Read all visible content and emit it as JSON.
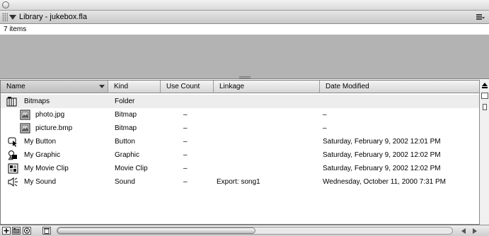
{
  "panel": {
    "title": "Library - jukebox.fla",
    "item_count": "7 items"
  },
  "columns": {
    "name": "Name",
    "kind": "Kind",
    "use_count": "Use Count",
    "linkage": "Linkage",
    "date_modified": "Date Modified"
  },
  "items": [
    {
      "name": "Bitmaps",
      "kind": "Folder",
      "use_count": "",
      "linkage": "",
      "date": "",
      "icon": "folder-icon"
    },
    {
      "name": "photo.jpg",
      "kind": "Bitmap",
      "use_count": "–",
      "linkage": "",
      "date": "–",
      "icon": "bitmap-icon"
    },
    {
      "name": "picture.bmp",
      "kind": "Bitmap",
      "use_count": "–",
      "linkage": "",
      "date": "–",
      "icon": "bitmap-icon"
    },
    {
      "name": "My Button",
      "kind": "Button",
      "use_count": "–",
      "linkage": "",
      "date": "Saturday, February 9, 2002  12:01 PM",
      "icon": "button-symbol-icon"
    },
    {
      "name": "My Graphic",
      "kind": "Graphic",
      "use_count": "–",
      "linkage": "",
      "date": "Saturday, February 9, 2002  12:02 PM",
      "icon": "graphic-symbol-icon"
    },
    {
      "name": "My Movie Clip",
      "kind": "Movie Clip",
      "use_count": "–",
      "linkage": "",
      "date": "Saturday, February 9, 2002  12:02 PM",
      "icon": "movie-clip-icon"
    },
    {
      "name": "My Sound",
      "kind": "Sound",
      "use_count": "–",
      "linkage": "Export: song1",
      "date": "Wednesday, October 11, 2000  7:31 PM",
      "icon": "sound-icon"
    }
  ],
  "colors": {
    "folder_row": "#ededed",
    "preview_bg": "#b3b3b3"
  }
}
